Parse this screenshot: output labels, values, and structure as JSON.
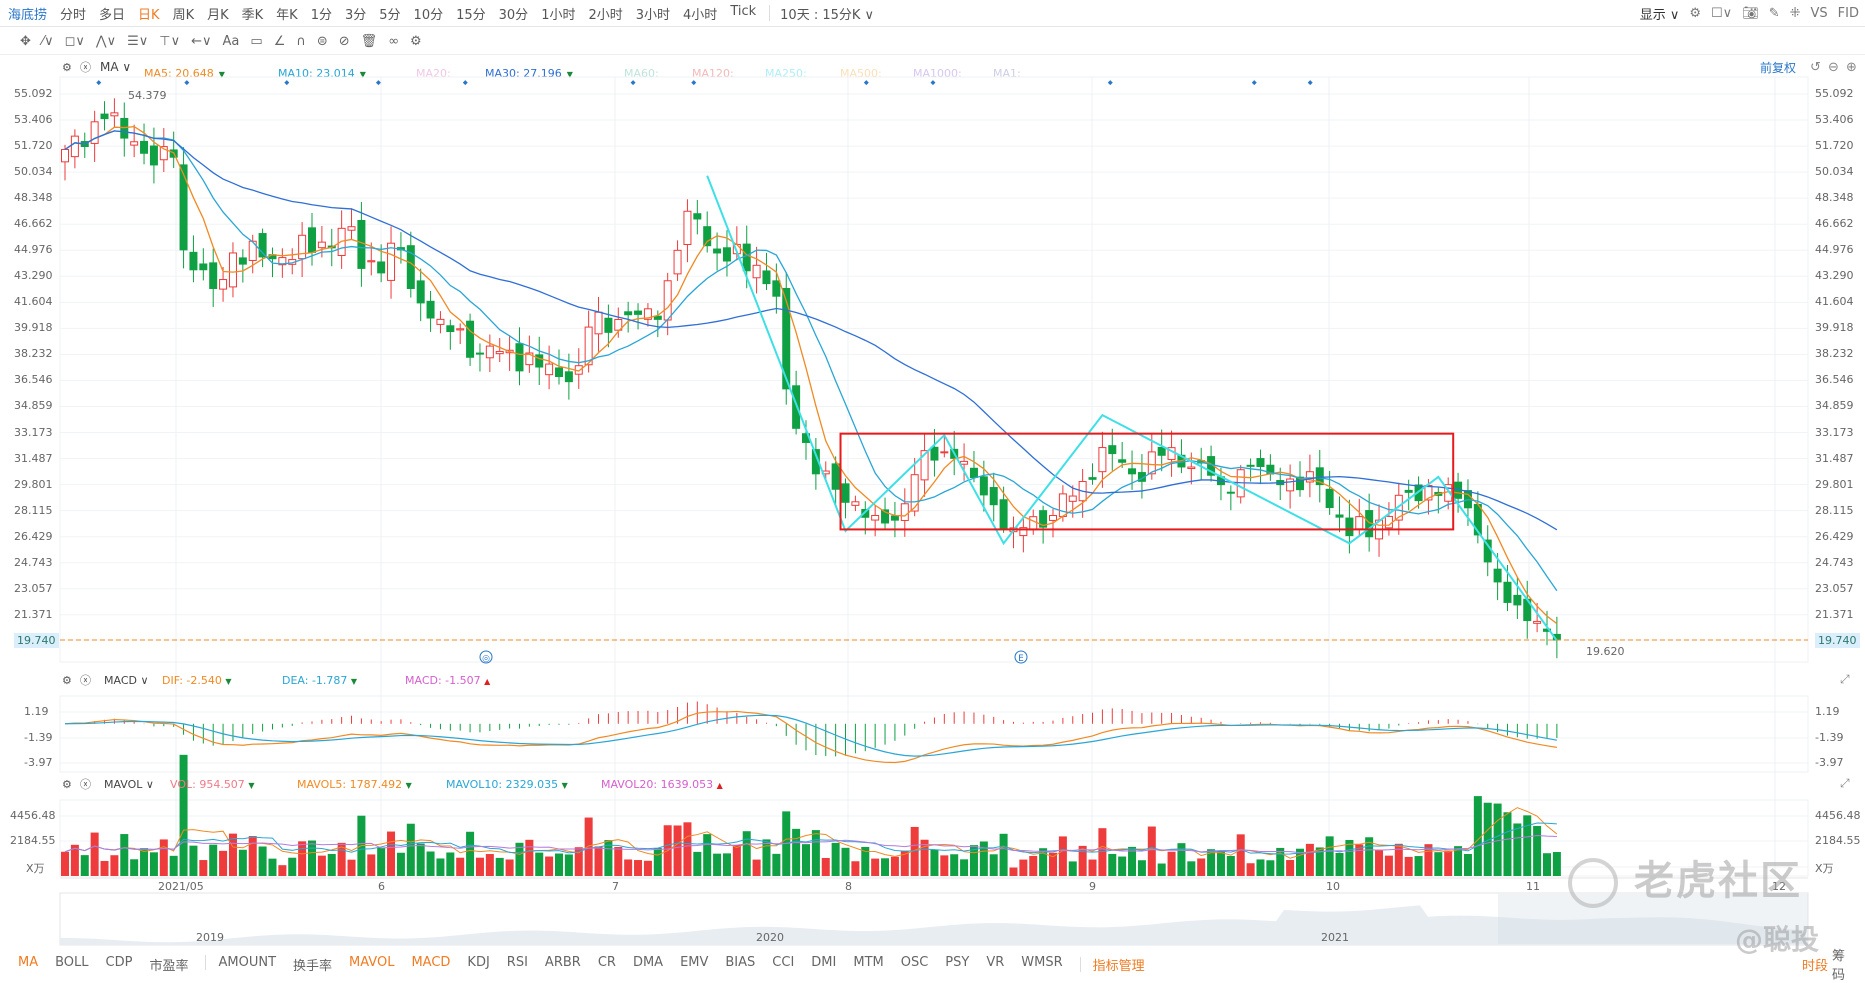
{
  "topbar": {
    "brand": "海底捞",
    "periods": [
      "分时",
      "多日",
      "日K",
      "周K",
      "月K",
      "季K",
      "年K",
      "1分",
      "3分",
      "5分",
      "10分",
      "15分",
      "30分",
      "1小时",
      "2小时",
      "3小时",
      "4小时",
      "Tick"
    ],
    "selected": "日K",
    "range": "10天 : 15分K ∨",
    "display": "显示 ∨",
    "vs": "VS",
    "fid": "FID"
  },
  "toolbar": {
    "icons": [
      "move-icon",
      "line-tool-icon",
      "rect-tool-icon",
      "wave-tool-icon",
      "fib-tool-icon",
      "vertical-tool-icon",
      "arrow-tool-icon",
      "text-tool-icon",
      "note-tool-icon",
      "angle-icon",
      "magnet-icon",
      "link-icon",
      "hide-icon",
      "trash-icon",
      "compare-icon",
      "settings-icon"
    ],
    "text_tool": "Aa"
  },
  "ma_legend": {
    "name": "MA ∨",
    "items": [
      {
        "label": "MA5: 20.648",
        "color": "#f08a24",
        "arrow": "▼",
        "arrow_color": "#1a8a3a"
      },
      {
        "label": "MA10: 23.014",
        "color": "#2aa6d6",
        "arrow": "▼",
        "arrow_color": "#1a8a3a"
      },
      {
        "label": "MA20:",
        "color": "#f0c8e6"
      },
      {
        "label": "MA30: 27.196",
        "color": "#2f6fd6",
        "arrow": "▼",
        "arrow_color": "#1a8a3a"
      },
      {
        "label": "MA60:",
        "color": "#bfe4da"
      },
      {
        "label": "MA120:",
        "color": "#f4b9b9"
      },
      {
        "label": "MA250:",
        "color": "#b0eef5"
      },
      {
        "label": "MA500:",
        "color": "#fbe0b8"
      },
      {
        "label": "MA1000:",
        "color": "#d8c6f0"
      },
      {
        "label": "MA1:",
        "color": "#cdcde6"
      }
    ],
    "adjust": "前复权"
  },
  "price_axis": [
    "55.092",
    "53.406",
    "51.720",
    "50.034",
    "48.348",
    "46.662",
    "44.976",
    "43.290",
    "41.604",
    "39.918",
    "38.232",
    "36.546",
    "34.859",
    "33.173",
    "31.487",
    "29.801",
    "28.115",
    "26.429",
    "24.743",
    "23.057",
    "21.371",
    "19.740"
  ],
  "annotations": {
    "high_label": "54.379",
    "low_label": "19.620",
    "current_price": "19.740",
    "marker_1": "◎",
    "marker_2": "E"
  },
  "macd_legend": {
    "name": "MACD ∨",
    "dif": "DIF: -2.540",
    "dea": "DEA: -1.787",
    "macd": "MACD: -1.507",
    "axis": [
      "1.19",
      "-1.39",
      "-3.97"
    ]
  },
  "vol_legend": {
    "name": "MAVOL ∨",
    "vol": "VOL: 954.507",
    "mavol5": "MAVOL5: 1787.492",
    "mavol10": "MAVOL10: 2329.035",
    "mavol20": "MAVOL20: 1639.053",
    "axis": [
      "4456.48",
      "2184.55",
      "X万"
    ]
  },
  "date_axis": [
    "2021/05",
    "6",
    "7",
    "8",
    "9",
    "10",
    "11",
    "12"
  ],
  "navigator": [
    "2019",
    "2020",
    "2021"
  ],
  "bottom": {
    "items": [
      "MA",
      "BOLL",
      "CDP",
      "市盈率",
      "AMOUNT",
      "换手率",
      "MAVOL",
      "MACD",
      "KDJ",
      "RSI",
      "ARBR",
      "CR",
      "DMA",
      "EMV",
      "BIAS",
      "CCI",
      "DMI",
      "MTM",
      "OSC",
      "PSY",
      "VR",
      "WMSR"
    ],
    "active": [
      "MA",
      "MAVOL",
      "MACD"
    ],
    "manage": "指标管理",
    "period": "时段",
    "chips": "筹码"
  },
  "watermark": {
    "logo": "老虎社区",
    "author": "@聪投"
  },
  "colors": {
    "up": "#ee3b3b",
    "down": "#0ea043",
    "ma5": "#f08a24",
    "ma10": "#2aa6d6",
    "ma30": "#2f6fd6",
    "zigzag": "#3ee0e8",
    "box": "#e8191a"
  },
  "chart_data": {
    "type": "candlestick",
    "bars": 152,
    "close_keyframes": [
      [
        0,
        51.5
      ],
      [
        4,
        53.5
      ],
      [
        7,
        52
      ],
      [
        9,
        50.5
      ],
      [
        11,
        51
      ],
      [
        12,
        45
      ],
      [
        15,
        42.5
      ],
      [
        17,
        44.8
      ],
      [
        22,
        44.5
      ],
      [
        26,
        45.5
      ],
      [
        29,
        46.5
      ],
      [
        30,
        43.8
      ],
      [
        34,
        45
      ],
      [
        35,
        42.5
      ],
      [
        38,
        40.5
      ],
      [
        42,
        38.3
      ],
      [
        45,
        38.5
      ],
      [
        50,
        36.8
      ],
      [
        52,
        37.5
      ],
      [
        53,
        40
      ],
      [
        57,
        40.8
      ],
      [
        60,
        40.5
      ],
      [
        61,
        43
      ],
      [
        63,
        47.5
      ],
      [
        64,
        47
      ],
      [
        66,
        44.8
      ],
      [
        70,
        44
      ],
      [
        72,
        42
      ],
      [
        73,
        36
      ],
      [
        76,
        30.5
      ],
      [
        78,
        29.5
      ],
      [
        82,
        27.8
      ],
      [
        84,
        27.5
      ],
      [
        87,
        32
      ],
      [
        90,
        31.5
      ],
      [
        94,
        28.5
      ],
      [
        96,
        27
      ],
      [
        100,
        27.8
      ],
      [
        103,
        30
      ],
      [
        105,
        32.2
      ],
      [
        108,
        30.5
      ],
      [
        111,
        31.7
      ],
      [
        115,
        31.2
      ],
      [
        117,
        29.8
      ],
      [
        120,
        31
      ],
      [
        123,
        29.8
      ],
      [
        127,
        29.8
      ],
      [
        130,
        26.5
      ],
      [
        133,
        27.5
      ],
      [
        136,
        29.3
      ],
      [
        140,
        29.8
      ],
      [
        142,
        28.3
      ],
      [
        145,
        23.5
      ],
      [
        148,
        21
      ],
      [
        150,
        20.3
      ],
      [
        151,
        19.74
      ]
    ],
    "zigzag": [
      [
        65,
        49.8
      ],
      [
        79,
        26.8
      ],
      [
        89,
        33
      ],
      [
        95,
        26
      ],
      [
        105,
        34.3
      ],
      [
        130,
        26
      ],
      [
        139,
        30.3
      ],
      [
        151,
        19.7
      ]
    ],
    "box": {
      "from": 79,
      "to": 140,
      "top": 33.1,
      "bottom": 26.9
    },
    "ylim": [
      19.74,
      55.092
    ],
    "macd_ylim": [
      -4.6,
      2.2
    ],
    "vol_ylim": [
      0,
      6500
    ]
  }
}
